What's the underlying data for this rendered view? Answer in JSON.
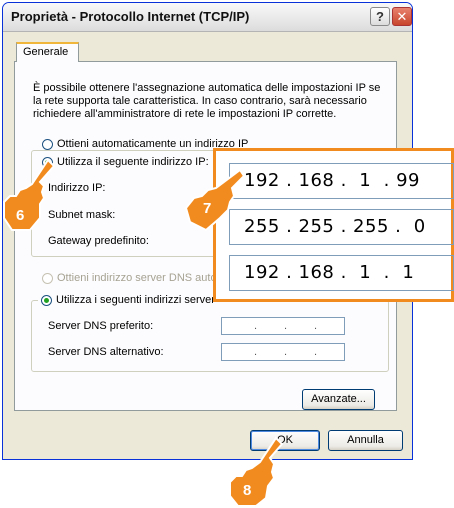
{
  "window": {
    "title": "Proprietà - Protocollo Internet (TCP/IP)",
    "help_glyph": "?",
    "close_glyph": "✕"
  },
  "tabs": [
    {
      "label": "Generale"
    }
  ],
  "description": "È possibile ottenere l'assegnazione automatica delle impostazioni IP se la rete supporta tale caratteristica. In caso contrario, sarà necessario richiedere all'amministratore di rete le impostazioni IP corrette.",
  "ip_section": {
    "auto_radio": "Ottieni automaticamente un indirizzo IP",
    "manual_radio": "Utilizza il seguente indirizzo IP:",
    "ip_label": "Indirizzo IP:",
    "subnet_label": "Subnet mask:",
    "gateway_label": "Gateway predefinito:"
  },
  "dns_section": {
    "auto_radio": "Ottieni indirizzo server DNS auto",
    "manual_radio": "Utilizza i seguenti indirizzi server",
    "preferred_label": "Server DNS preferito:",
    "alternate_label": "Server DNS alternativo:"
  },
  "zoom_fields": {
    "ip": "192 . 168 .  1  . 99",
    "subnet": "255 . 255 . 255 .  0",
    "gateway": "192 . 168 .  1  .  1"
  },
  "buttons": {
    "advanced": "Avanzate...",
    "ok": "OK",
    "cancel": "Annulla"
  },
  "callouts": {
    "step6": "6",
    "step7": "7",
    "step8": "8"
  },
  "colors": {
    "callout_orange": "#f28b1f",
    "selected_radio": "#21a121",
    "xp_border_blue": "#0831d9"
  }
}
